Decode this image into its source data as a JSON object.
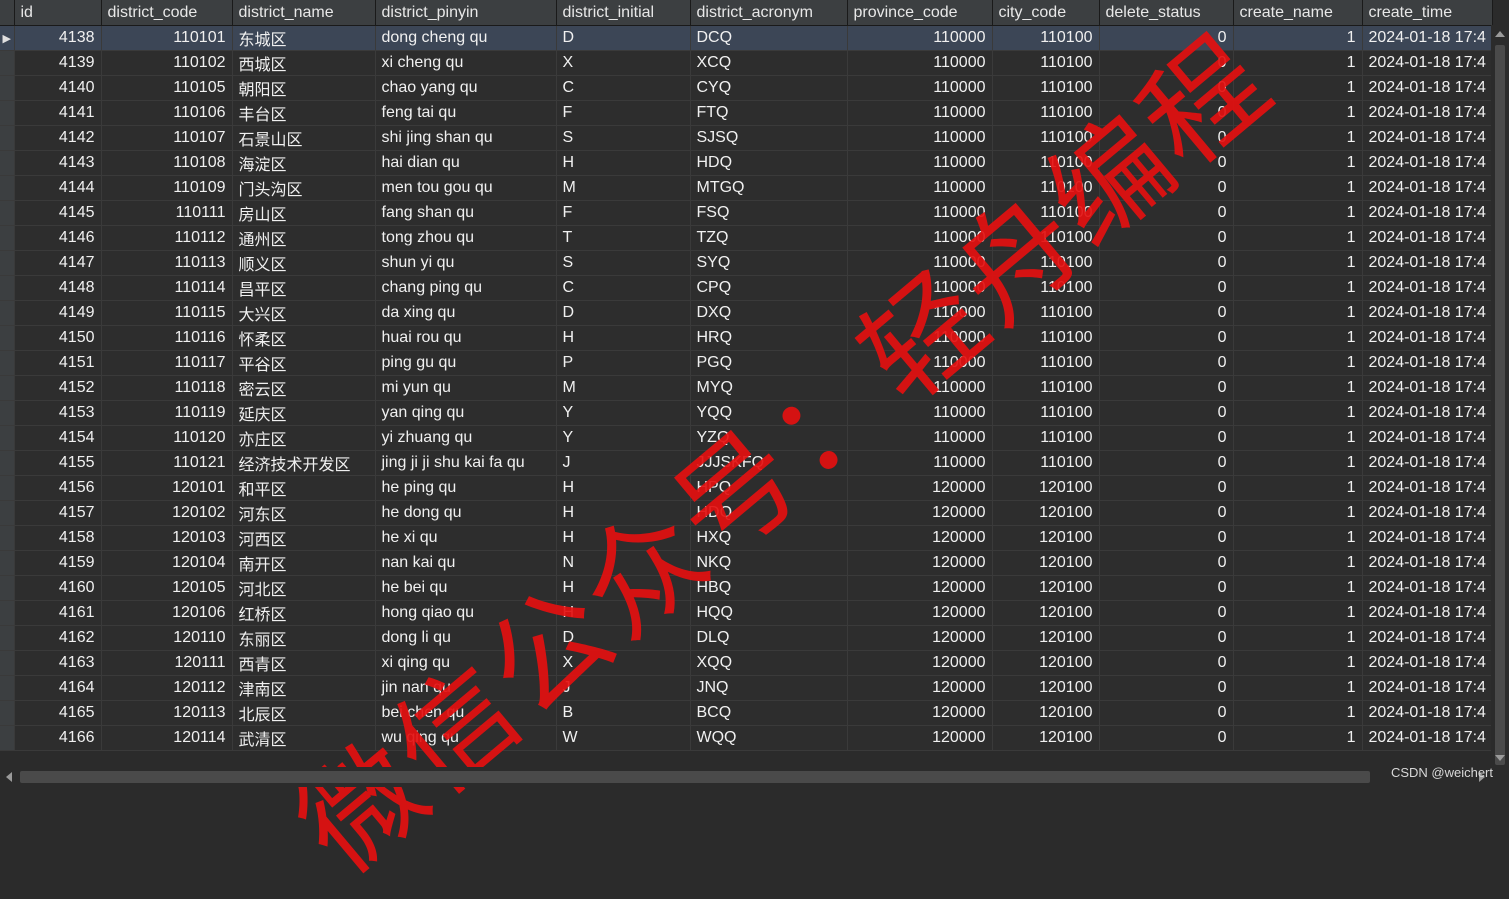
{
  "columns": [
    "id",
    "district_code",
    "district_name",
    "district_pinyin",
    "district_initial",
    "district_acronym",
    "province_code",
    "city_code",
    "delete_status",
    "create_name",
    "create_time"
  ],
  "selected_row_index": 0,
  "row_marker": "▶",
  "rows": [
    [
      "4138",
      "110101",
      "东城区",
      "dong cheng qu",
      "D",
      "DCQ",
      "110000",
      "110100",
      "0",
      "1",
      "2024-01-18 17:4"
    ],
    [
      "4139",
      "110102",
      "西城区",
      "xi cheng qu",
      "X",
      "XCQ",
      "110000",
      "110100",
      "0",
      "1",
      "2024-01-18 17:4"
    ],
    [
      "4140",
      "110105",
      "朝阳区",
      "chao yang qu",
      "C",
      "CYQ",
      "110000",
      "110100",
      "0",
      "1",
      "2024-01-18 17:4"
    ],
    [
      "4141",
      "110106",
      "丰台区",
      "feng tai qu",
      "F",
      "FTQ",
      "110000",
      "110100",
      "0",
      "1",
      "2024-01-18 17:4"
    ],
    [
      "4142",
      "110107",
      "石景山区",
      "shi jing shan qu",
      "S",
      "SJSQ",
      "110000",
      "110100",
      "0",
      "1",
      "2024-01-18 17:4"
    ],
    [
      "4143",
      "110108",
      "海淀区",
      "hai dian qu",
      "H",
      "HDQ",
      "110000",
      "110100",
      "0",
      "1",
      "2024-01-18 17:4"
    ],
    [
      "4144",
      "110109",
      "门头沟区",
      "men tou gou qu",
      "M",
      "MTGQ",
      "110000",
      "110100",
      "0",
      "1",
      "2024-01-18 17:4"
    ],
    [
      "4145",
      "110111",
      "房山区",
      "fang shan qu",
      "F",
      "FSQ",
      "110000",
      "110100",
      "0",
      "1",
      "2024-01-18 17:4"
    ],
    [
      "4146",
      "110112",
      "通州区",
      "tong zhou qu",
      "T",
      "TZQ",
      "110000",
      "110100",
      "0",
      "1",
      "2024-01-18 17:4"
    ],
    [
      "4147",
      "110113",
      "顺义区",
      "shun yi qu",
      "S",
      "SYQ",
      "110000",
      "110100",
      "0",
      "1",
      "2024-01-18 17:4"
    ],
    [
      "4148",
      "110114",
      "昌平区",
      "chang ping qu",
      "C",
      "CPQ",
      "110000",
      "110100",
      "0",
      "1",
      "2024-01-18 17:4"
    ],
    [
      "4149",
      "110115",
      "大兴区",
      "da xing qu",
      "D",
      "DXQ",
      "110000",
      "110100",
      "0",
      "1",
      "2024-01-18 17:4"
    ],
    [
      "4150",
      "110116",
      "怀柔区",
      "huai rou qu",
      "H",
      "HRQ",
      "110000",
      "110100",
      "0",
      "1",
      "2024-01-18 17:4"
    ],
    [
      "4151",
      "110117",
      "平谷区",
      "ping gu qu",
      "P",
      "PGQ",
      "110000",
      "110100",
      "0",
      "1",
      "2024-01-18 17:4"
    ],
    [
      "4152",
      "110118",
      "密云区",
      "mi yun qu",
      "M",
      "MYQ",
      "110000",
      "110100",
      "0",
      "1",
      "2024-01-18 17:4"
    ],
    [
      "4153",
      "110119",
      "延庆区",
      "yan qing qu",
      "Y",
      "YQQ",
      "110000",
      "110100",
      "0",
      "1",
      "2024-01-18 17:4"
    ],
    [
      "4154",
      "110120",
      "亦庄区",
      "yi zhuang qu",
      "Y",
      "YZQ",
      "110000",
      "110100",
      "0",
      "1",
      "2024-01-18 17:4"
    ],
    [
      "4155",
      "110121",
      "经济技术开发区",
      "jing ji ji shu kai fa qu",
      "J",
      "JJJSKFQ",
      "110000",
      "110100",
      "0",
      "1",
      "2024-01-18 17:4"
    ],
    [
      "4156",
      "120101",
      "和平区",
      "he ping qu",
      "H",
      "HPQ",
      "120000",
      "120100",
      "0",
      "1",
      "2024-01-18 17:4"
    ],
    [
      "4157",
      "120102",
      "河东区",
      "he dong qu",
      "H",
      "HDQ",
      "120000",
      "120100",
      "0",
      "1",
      "2024-01-18 17:4"
    ],
    [
      "4158",
      "120103",
      "河西区",
      "he xi qu",
      "H",
      "HXQ",
      "120000",
      "120100",
      "0",
      "1",
      "2024-01-18 17:4"
    ],
    [
      "4159",
      "120104",
      "南开区",
      "nan kai qu",
      "N",
      "NKQ",
      "120000",
      "120100",
      "0",
      "1",
      "2024-01-18 17:4"
    ],
    [
      "4160",
      "120105",
      "河北区",
      "he bei qu",
      "H",
      "HBQ",
      "120000",
      "120100",
      "0",
      "1",
      "2024-01-18 17:4"
    ],
    [
      "4161",
      "120106",
      "红桥区",
      "hong qiao qu",
      "H",
      "HQQ",
      "120000",
      "120100",
      "0",
      "1",
      "2024-01-18 17:4"
    ],
    [
      "4162",
      "120110",
      "东丽区",
      "dong li qu",
      "D",
      "DLQ",
      "120000",
      "120100",
      "0",
      "1",
      "2024-01-18 17:4"
    ],
    [
      "4163",
      "120111",
      "西青区",
      "xi qing qu",
      "X",
      "XQQ",
      "120000",
      "120100",
      "0",
      "1",
      "2024-01-18 17:4"
    ],
    [
      "4164",
      "120112",
      "津南区",
      "jin nan qu",
      "J",
      "JNQ",
      "120000",
      "120100",
      "0",
      "1",
      "2024-01-18 17:4"
    ],
    [
      "4165",
      "120113",
      "北辰区",
      "bei chen qu",
      "B",
      "BCQ",
      "120000",
      "120100",
      "0",
      "1",
      "2024-01-18 17:4"
    ],
    [
      "4166",
      "120114",
      "武清区",
      "wu qing qu",
      "W",
      "WQQ",
      "120000",
      "120100",
      "0",
      "1",
      "2024-01-18 17:4"
    ]
  ],
  "watermark_text": "微信公众号：轻舟编程",
  "credit_text": "CSDN @weichert",
  "colors": {
    "background": "#2b2b2b",
    "header": "#3c3f41",
    "selected_row": "#3c4656",
    "watermark": "#e41010"
  }
}
